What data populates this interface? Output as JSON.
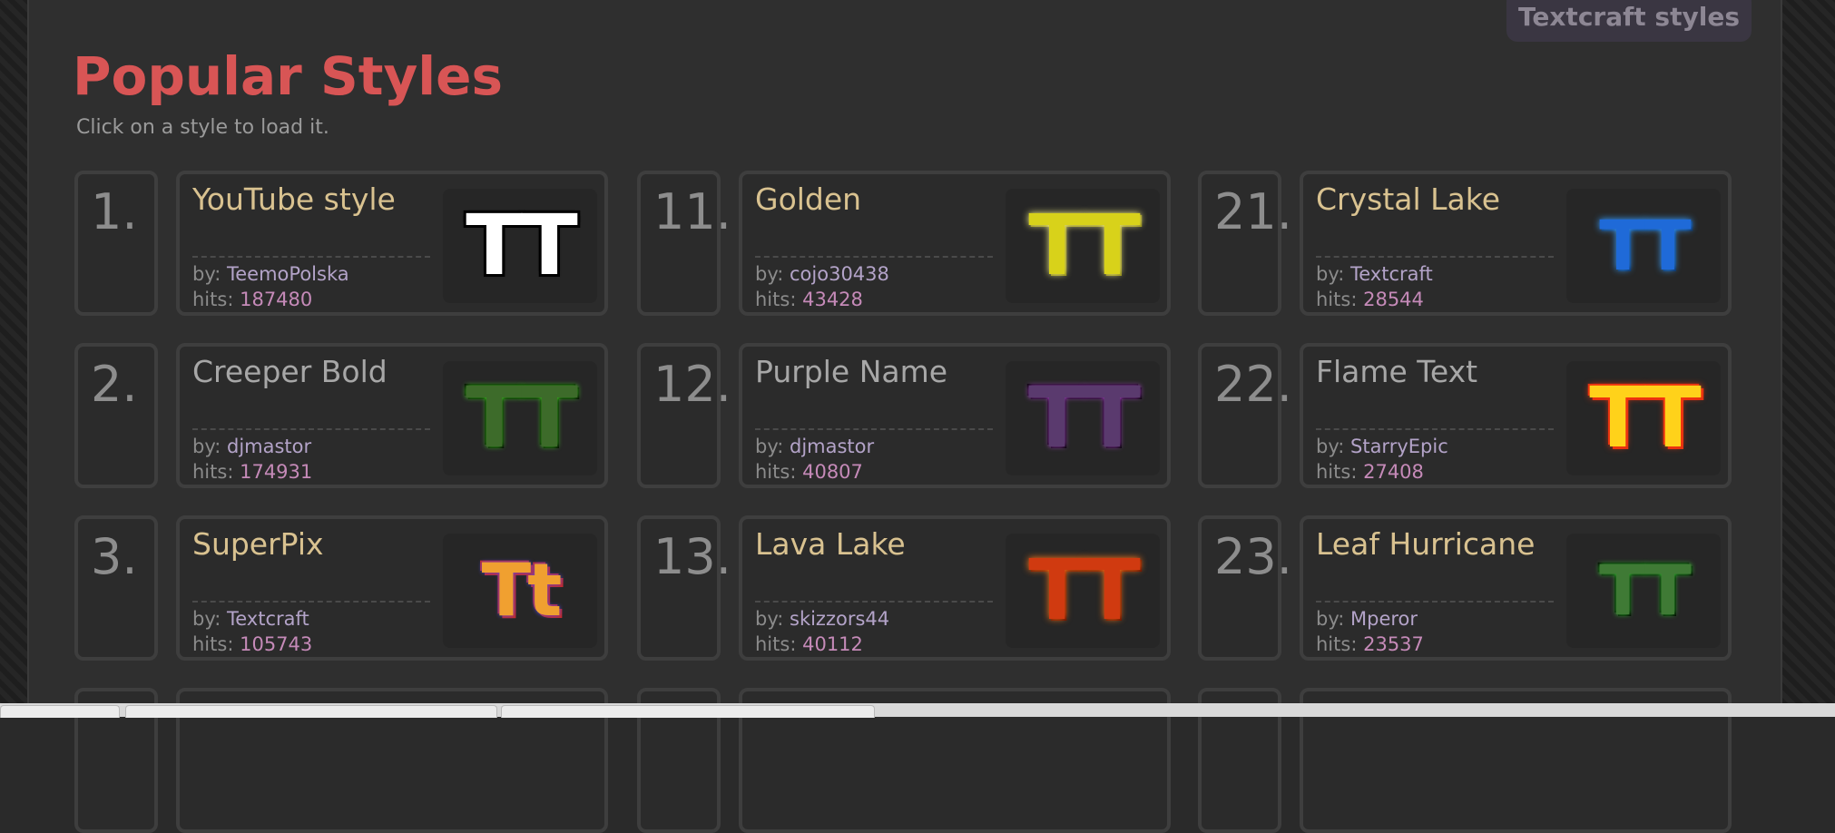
{
  "header": {
    "title": "Popular Styles",
    "subtitle": "Click on a style to load it.",
    "top_tab": "Textcraft styles"
  },
  "labels": {
    "by": "by:",
    "hits": "hits:"
  },
  "styles": [
    {
      "rank": "1.",
      "name": "YouTube style",
      "author": "TeemoPolska",
      "hits": "187480",
      "thumb_text": "TT",
      "thumb_color": "#ffffff",
      "thumb_glow": "#000000",
      "thumb_icon": "youtube-style-thumbnail"
    },
    {
      "rank": "2.",
      "name": "Creeper Bold",
      "author": "djmastor",
      "hits": "174931",
      "thumb_text": "TT",
      "thumb_color": "#3d6b2a",
      "thumb_glow": "#4ce22b",
      "thumb_icon": "creeper-bold-thumbnail"
    },
    {
      "rank": "3.",
      "name": "SuperPix",
      "author": "Textcraft",
      "hits": "105743",
      "thumb_text": "Tt",
      "thumb_color": "#f0a030",
      "thumb_glow": "#5b4cf0",
      "thumb_icon": "superpix-thumbnail"
    },
    {
      "rank": "11.",
      "name": "Golden",
      "author": "cojo30438",
      "hits": "43428",
      "thumb_text": "TT",
      "thumb_color": "#d8d21a",
      "thumb_glow": "#f5f08a",
      "thumb_icon": "golden-thumbnail"
    },
    {
      "rank": "12.",
      "name": "Purple Name",
      "author": "djmastor",
      "hits": "40807",
      "thumb_text": "TT",
      "thumb_color": "#5a3a6e",
      "thumb_glow": "#b24bd0",
      "thumb_icon": "purple-name-thumbnail"
    },
    {
      "rank": "13.",
      "name": "Lava Lake",
      "author": "skizzors44",
      "hits": "40112",
      "thumb_text": "TT",
      "thumb_color": "#d03a10",
      "thumb_glow": "#ff7a1a",
      "thumb_icon": "lava-lake-thumbnail"
    },
    {
      "rank": "21.",
      "name": "Crystal Lake",
      "author": "Textcraft",
      "hits": "28544",
      "thumb_text": "TT",
      "thumb_color": "#1f6ad8",
      "thumb_glow": "#3aa0ff",
      "thumb_icon": "crystal-lake-thumbnail"
    },
    {
      "rank": "22.",
      "name": "Flame Text",
      "author": "StarryEpic",
      "hits": "27408",
      "thumb_text": "TT",
      "thumb_color": "#ffd21a",
      "thumb_glow": "#ff3a10",
      "thumb_icon": "flame-text-thumbnail"
    },
    {
      "rank": "23.",
      "name": "Leaf Hurricane",
      "author": "Mperor",
      "hits": "23537",
      "thumb_text": "TT",
      "thumb_color": "#3f7a35",
      "thumb_glow": "#3cd43a",
      "thumb_icon": "leaf-hurricane-thumbnail"
    }
  ]
}
